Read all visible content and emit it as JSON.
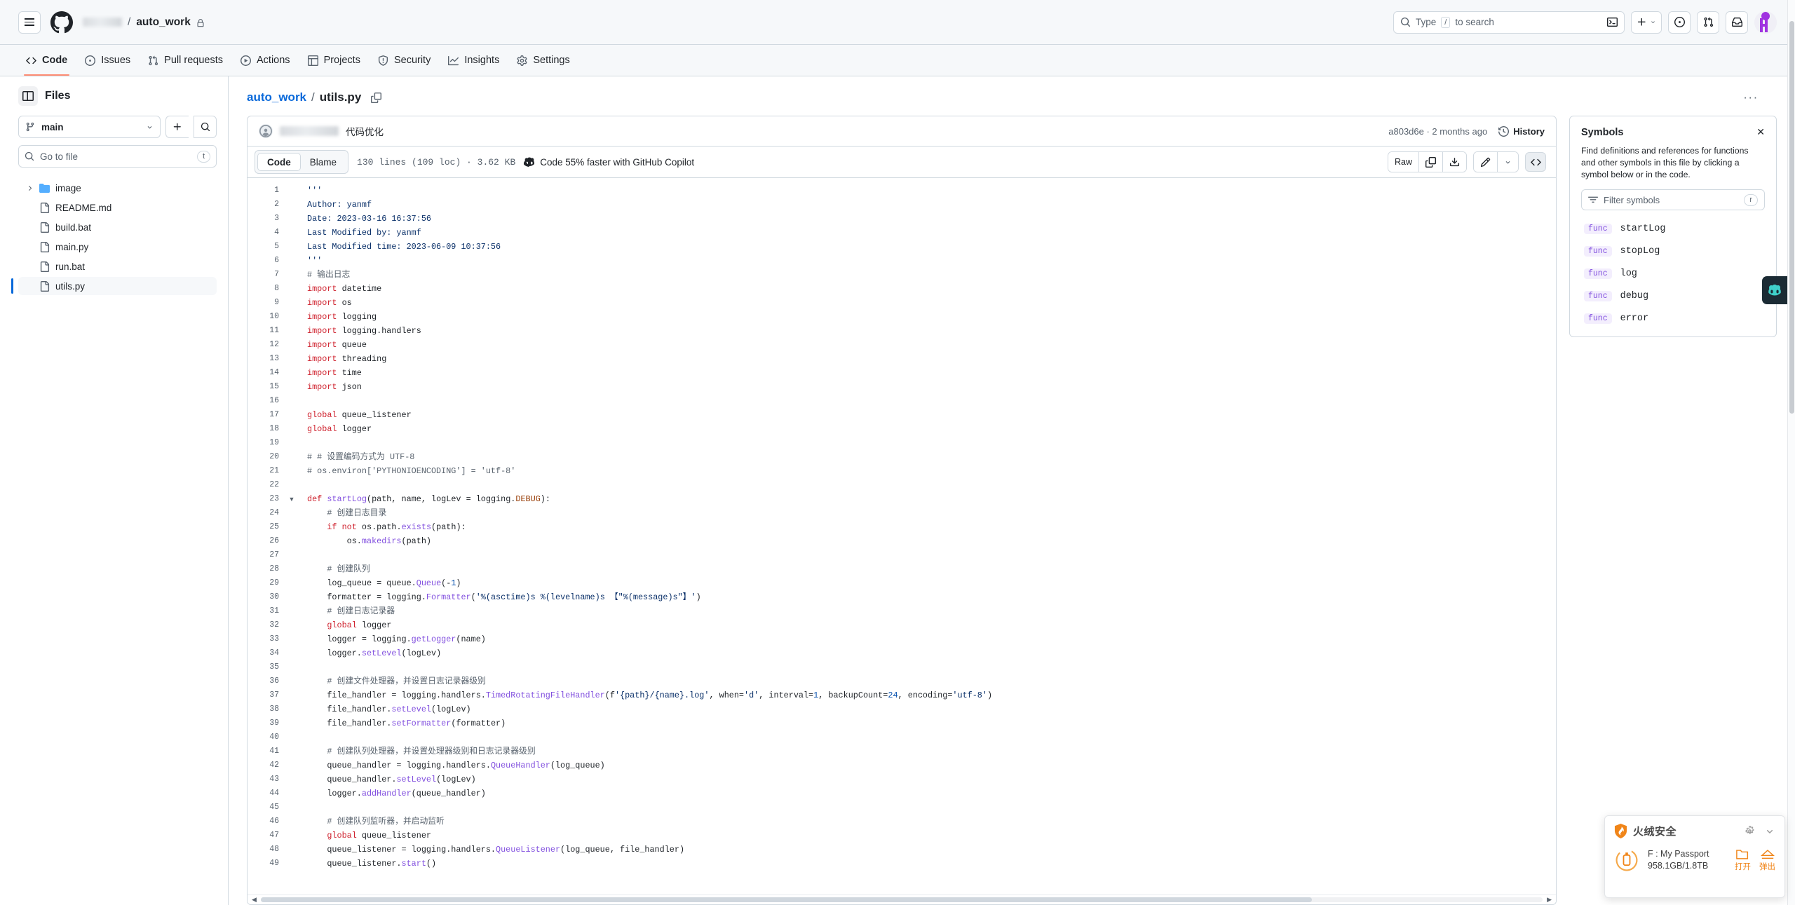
{
  "header": {
    "owner_blurred": true,
    "repo": "auto_work",
    "separator": "/",
    "search_placeholder": "Type ",
    "search_key": "/",
    "search_placeholder_tail": " to search",
    "icons": {
      "hamburger": "hamburger-icon",
      "github_logo": "github-logo-icon",
      "lock": "lock-icon",
      "terminal": "terminal-icon",
      "plus": "plus-icon",
      "issues": "issue-opened-icon",
      "pulls": "git-pull-request-icon",
      "inbox": "inbox-icon",
      "avatar": "user-avatar"
    }
  },
  "repo_nav": [
    {
      "label": "Code",
      "icon": "code-icon",
      "active": true
    },
    {
      "label": "Issues",
      "icon": "issue-opened-icon",
      "active": false
    },
    {
      "label": "Pull requests",
      "icon": "git-pull-request-icon",
      "active": false
    },
    {
      "label": "Actions",
      "icon": "play-icon",
      "active": false
    },
    {
      "label": "Projects",
      "icon": "table-icon",
      "active": false
    },
    {
      "label": "Security",
      "icon": "shield-icon",
      "active": false
    },
    {
      "label": "Insights",
      "icon": "graph-icon",
      "active": false
    },
    {
      "label": "Settings",
      "icon": "gear-icon",
      "active": false
    }
  ],
  "sidebar": {
    "title": "Files",
    "branch": "main",
    "gotofile_placeholder": "Go to file",
    "gotofile_key": "t",
    "tree": [
      {
        "name": "image",
        "type": "folder",
        "selected": false
      },
      {
        "name": "README.md",
        "type": "file",
        "selected": false
      },
      {
        "name": "build.bat",
        "type": "file",
        "selected": false
      },
      {
        "name": "main.py",
        "type": "file",
        "selected": false
      },
      {
        "name": "run.bat",
        "type": "file",
        "selected": false
      },
      {
        "name": "utils.py",
        "type": "file",
        "selected": true
      }
    ]
  },
  "file": {
    "breadcrumb_repo": "auto_work",
    "breadcrumb_sep": "/",
    "breadcrumb_name": "utils.py",
    "kebab": "···",
    "commit": {
      "message": "代码优化",
      "hash": "a803d6e",
      "age": "2 months ago",
      "meta": "a803d6e · 2 months ago",
      "history_label": "History"
    },
    "toolbar": {
      "code_tab": "Code",
      "blame_tab": "Blame",
      "meta": "130 lines (109 loc) · 3.62 KB",
      "copilot_hint": "Code 55% faster with GitHub Copilot",
      "raw_label": "Raw"
    }
  },
  "symbols": {
    "title": "Symbols",
    "description": "Find definitions and references for functions and other symbols in this file by clicking a symbol below or in the code.",
    "filter_placeholder": "Filter symbols",
    "filter_key": "r",
    "close": "✕",
    "items": [
      {
        "kind": "func",
        "name": "startLog"
      },
      {
        "kind": "func",
        "name": "stopLog"
      },
      {
        "kind": "func",
        "name": "log"
      },
      {
        "kind": "func",
        "name": "debug"
      },
      {
        "kind": "func",
        "name": "error"
      }
    ]
  },
  "code": {
    "language": "python",
    "lines": [
      {
        "n": 1,
        "fold": "",
        "html": "<span class=\"s\">'''</span>"
      },
      {
        "n": 2,
        "fold": "",
        "html": "<span class=\"s\">Author: yanmf</span>"
      },
      {
        "n": 3,
        "fold": "",
        "html": "<span class=\"s\">Date: 2023-03-16 16:37:56</span>"
      },
      {
        "n": 4,
        "fold": "",
        "html": "<span class=\"s\">Last Modified by: yanmf</span>"
      },
      {
        "n": 5,
        "fold": "",
        "html": "<span class=\"s\">Last Modified time: 2023-06-09 10:37:56</span>"
      },
      {
        "n": 6,
        "fold": "",
        "html": "<span class=\"s\">'''</span>"
      },
      {
        "n": 7,
        "fold": "",
        "html": "<span class=\"c\"># 输出日志</span>"
      },
      {
        "n": 8,
        "fold": "",
        "html": "<span class=\"k\">import</span> datetime"
      },
      {
        "n": 9,
        "fold": "",
        "html": "<span class=\"k\">import</span> os"
      },
      {
        "n": 10,
        "fold": "",
        "html": "<span class=\"k\">import</span> logging"
      },
      {
        "n": 11,
        "fold": "",
        "html": "<span class=\"k\">import</span> logging.handlers"
      },
      {
        "n": 12,
        "fold": "",
        "html": "<span class=\"k\">import</span> queue"
      },
      {
        "n": 13,
        "fold": "",
        "html": "<span class=\"k\">import</span> threading"
      },
      {
        "n": 14,
        "fold": "",
        "html": "<span class=\"k\">import</span> time"
      },
      {
        "n": 15,
        "fold": "",
        "html": "<span class=\"k\">import</span> json"
      },
      {
        "n": 16,
        "fold": "",
        "html": ""
      },
      {
        "n": 17,
        "fold": "",
        "html": "<span class=\"k\">global</span> queue_listener"
      },
      {
        "n": 18,
        "fold": "",
        "html": "<span class=\"k\">global</span> logger"
      },
      {
        "n": 19,
        "fold": "",
        "html": ""
      },
      {
        "n": 20,
        "fold": "",
        "html": "<span class=\"c\"># # 设置编码方式为 UTF-8</span>"
      },
      {
        "n": 21,
        "fold": "",
        "html": "<span class=\"c\"># os.environ['PYTHONIOENCODING'] = 'utf-8'</span>"
      },
      {
        "n": 22,
        "fold": "",
        "html": ""
      },
      {
        "n": 23,
        "fold": "v",
        "html": "<span class=\"k\">def</span> <span class=\"f\">startLog</span>(path, name, logLev = logging.<span class=\"v\">DEBUG</span>):"
      },
      {
        "n": 24,
        "fold": "",
        "html": "    <span class=\"c\"># 创建日志目录</span>"
      },
      {
        "n": 25,
        "fold": "",
        "html": "    <span class=\"k\">if</span> <span class=\"k\">not</span> os.path.<span class=\"f\">exists</span>(path):"
      },
      {
        "n": 26,
        "fold": "",
        "html": "        os.<span class=\"f\">makedirs</span>(path)"
      },
      {
        "n": 27,
        "fold": "",
        "html": ""
      },
      {
        "n": 28,
        "fold": "",
        "html": "    <span class=\"c\"># 创建队列</span>"
      },
      {
        "n": 29,
        "fold": "",
        "html": "    log_queue = queue.<span class=\"f\">Queue</span>(-<span class=\"n\">1</span>)"
      },
      {
        "n": 30,
        "fold": "",
        "html": "    formatter = logging.<span class=\"f\">Formatter</span>(<span class=\"s\">'%(asctime)s %(levelname)s 【\"%(message)s\"】'</span>)"
      },
      {
        "n": 31,
        "fold": "",
        "html": "    <span class=\"c\"># 创建日志记录器</span>"
      },
      {
        "n": 32,
        "fold": "",
        "html": "    <span class=\"k\">global</span> logger"
      },
      {
        "n": 33,
        "fold": "",
        "html": "    logger = logging.<span class=\"f\">getLogger</span>(name)"
      },
      {
        "n": 34,
        "fold": "",
        "html": "    logger.<span class=\"f\">setLevel</span>(logLev)"
      },
      {
        "n": 35,
        "fold": "",
        "html": ""
      },
      {
        "n": 36,
        "fold": "",
        "html": "    <span class=\"c\"># 创建文件处理器，并设置日志记录器级别</span>"
      },
      {
        "n": 37,
        "fold": "",
        "html": "    file_handler = logging.handlers.<span class=\"f\">TimedRotatingFileHandler</span>(f<span class=\"s\">'{path}/{name}.log'</span>, when=<span class=\"s\">'d'</span>, interval=<span class=\"n\">1</span>, backupCount=<span class=\"n\">24</span>, encoding=<span class=\"s\">'utf-8'</span>)"
      },
      {
        "n": 38,
        "fold": "",
        "html": "    file_handler.<span class=\"f\">setLevel</span>(logLev)"
      },
      {
        "n": 39,
        "fold": "",
        "html": "    file_handler.<span class=\"f\">setFormatter</span>(formatter)"
      },
      {
        "n": 40,
        "fold": "",
        "html": ""
      },
      {
        "n": 41,
        "fold": "",
        "html": "    <span class=\"c\"># 创建队列处理器，并设置处理器级别和日志记录器级别</span>"
      },
      {
        "n": 42,
        "fold": "",
        "html": "    queue_handler = logging.handlers.<span class=\"f\">QueueHandler</span>(log_queue)"
      },
      {
        "n": 43,
        "fold": "",
        "html": "    queue_handler.<span class=\"f\">setLevel</span>(logLev)"
      },
      {
        "n": 44,
        "fold": "",
        "html": "    logger.<span class=\"f\">addHandler</span>(queue_handler)"
      },
      {
        "n": 45,
        "fold": "",
        "html": ""
      },
      {
        "n": 46,
        "fold": "",
        "html": "    <span class=\"c\"># 创建队列监听器，并启动监听</span>"
      },
      {
        "n": 47,
        "fold": "",
        "html": "    <span class=\"k\">global</span> queue_listener"
      },
      {
        "n": 48,
        "fold": "",
        "html": "    queue_listener = logging.handlers.<span class=\"f\">QueueListener</span>(log_queue, file_handler)"
      },
      {
        "n": 49,
        "fold": "",
        "html": "    queue_listener.<span class=\"f\">start</span>()"
      }
    ]
  },
  "huorong": {
    "title": "火绒安全",
    "device_name": "F : My Passport",
    "device_size": "958.1GB/1.8TB",
    "open_label": "打开",
    "eject_label": "弹出"
  },
  "colors": {
    "accent": "#0969da",
    "active_tab_underline": "#fd8c73",
    "keyword": "#cf222e",
    "function": "#8250df",
    "string": "#0a3069",
    "comment": "#59636e",
    "huorong_orange": "#f08519"
  }
}
